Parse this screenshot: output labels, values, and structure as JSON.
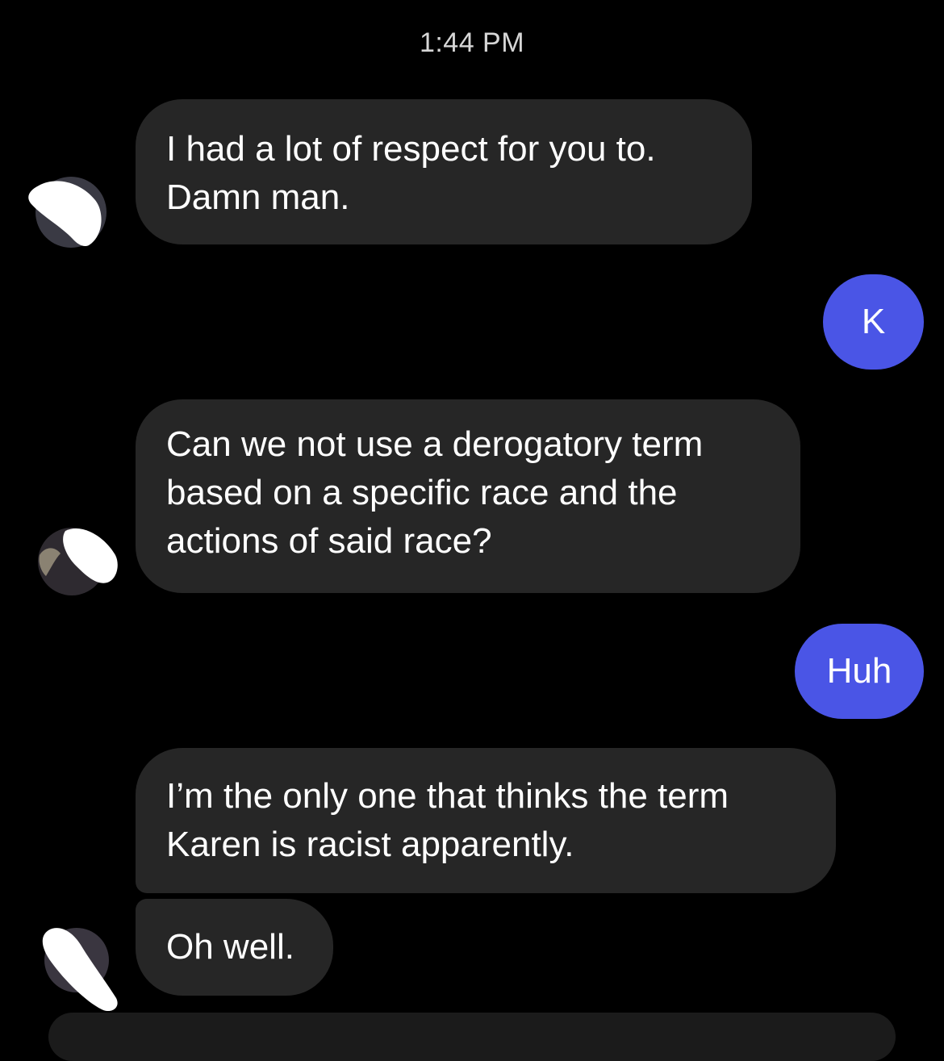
{
  "timestamp": "1:44 PM",
  "messages": [
    {
      "sender": "other",
      "lines": [
        "I had a lot of respect for you to.",
        "Damn man."
      ]
    },
    {
      "sender": "me",
      "text": "K"
    },
    {
      "sender": "other",
      "lines": [
        "Can we not use a derogatory term",
        "based on a specific race and the",
        "actions of said race?"
      ]
    },
    {
      "sender": "me",
      "text": "Huh"
    },
    {
      "sender": "other",
      "lines": [
        "I’m the only one that thinks the term",
        "Karen is racist apparently."
      ]
    },
    {
      "sender": "other",
      "lines": [
        "Oh well."
      ]
    }
  ],
  "colors": {
    "background": "#000000",
    "incoming_bubble": "#262626",
    "outgoing_bubble": "#4a55e6",
    "text": "#ffffff"
  },
  "icons": [
    "avatar-icon"
  ]
}
